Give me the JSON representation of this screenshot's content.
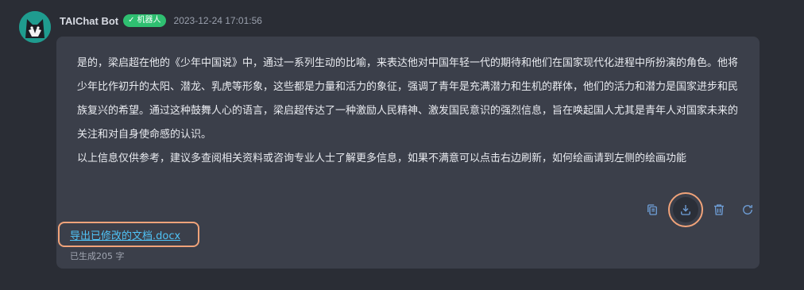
{
  "message": {
    "bot_name": "TAIChat Bot",
    "badge_label": "机器人",
    "timestamp": "2023-12-24 17:01:56",
    "paragraphs": [
      "是的，梁启超在他的《少年中国说》中，通过一系列生动的比喻，来表达他对中国年轻一代的期待和他们在国家现代化进程中所扮演的角色。他将少年比作初升的太阳、潜龙、乳虎等形象，这些都是力量和活力的象征，强调了青年是充满潜力和生机的群体，他们的活力和潜力是国家进步和民族复兴的希望。通过这种鼓舞人心的语言，梁启超传达了一种激励人民精神、激发国民意识的强烈信息，旨在唤起国人尤其是青年人对国家未来的关注和对自身使命感的认识。",
      "以上信息仅供参考，建议多查阅相关资料或咨询专业人士了解更多信息，如果不满意可以点击右边刷新，如何绘画请到左侧的绘画功能"
    ],
    "export_link": "导出已修改的文档.docx",
    "generated_count": "已生成205 字"
  },
  "actions": [
    {
      "name": "copy-icon"
    },
    {
      "name": "download-icon"
    },
    {
      "name": "trash-icon"
    },
    {
      "name": "refresh-icon"
    }
  ],
  "colors": {
    "background": "#2a2d35",
    "bubble": "#3b3f4a",
    "badge": "#2fbf71",
    "link": "#4fc3f7",
    "highlight": "#f0a37a",
    "icon": "#6f9fd8"
  }
}
